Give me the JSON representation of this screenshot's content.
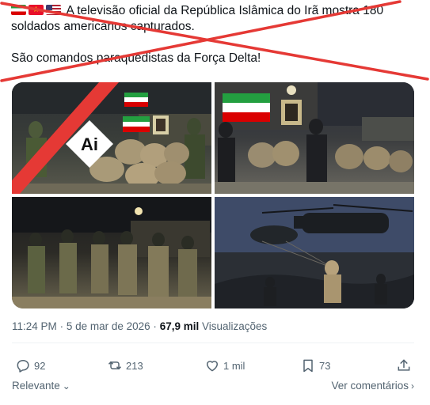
{
  "post": {
    "flags": [
      "iran-flag-icon",
      "star-flag-icon",
      "us-flag-icon"
    ],
    "text_line1": "A televisão oficial da República Islâmica do Irã mostra 180",
    "text_line2": "soldados americanos capturados.",
    "text_line3": "São comandos paraquedistas da Força Delta!",
    "cross_color": "#e53935"
  },
  "media": {
    "ai_badge": "Ai",
    "ai_slash_color": "#e53935",
    "images": [
      {
        "name": "captured-soldiers-kneeling-flags"
      },
      {
        "name": "captured-soldiers-kneeling-portrait"
      },
      {
        "name": "soldiers-marched-at-night"
      },
      {
        "name": "paratroopers-helicopter-dusk"
      }
    ]
  },
  "meta": {
    "time": "11:24 PM",
    "separator": "·",
    "date": "5 de mar de 2026",
    "separator2": "·",
    "views_count": "67,9 mil",
    "views_label": "Visualizações"
  },
  "actions": {
    "replies": "92",
    "reposts": "213",
    "likes": "1 mil",
    "bookmarks": "73"
  },
  "footer": {
    "sort_label": "Relevante",
    "see_comments": "Ver comentários"
  }
}
